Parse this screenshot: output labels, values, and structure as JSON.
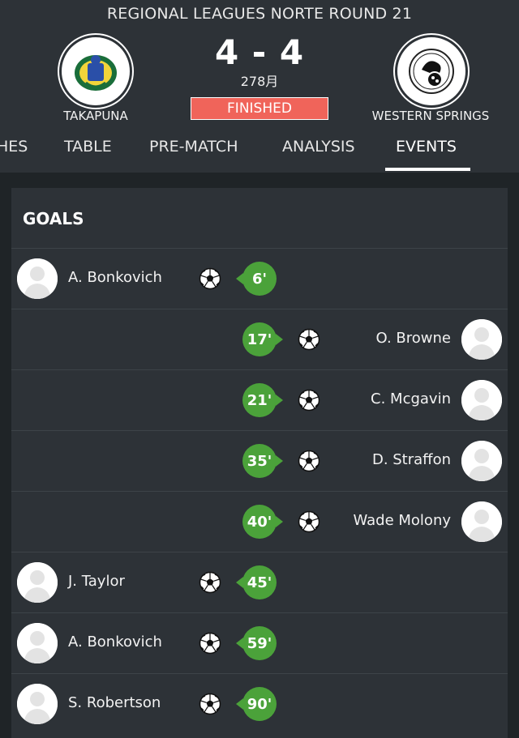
{
  "match": {
    "league_title": "REGIONAL LEAGUES  NORTE ROUND 21",
    "home_team": "TAKAPUNA",
    "away_team": "WESTERN SPRINGS",
    "score": "4 - 4",
    "date": "278月",
    "status": "FINISHED"
  },
  "tabs": [
    "HES",
    "TABLE",
    "PRE-MATCH",
    "ANALYSIS",
    "EVENTS"
  ],
  "active_tab": "EVENTS",
  "colors": {
    "background": "#1f2427",
    "panel": "#2d3237",
    "status_badge": "#f0645a",
    "minute_badge": "#4ba23a"
  },
  "goals_section": {
    "title": "GOALS",
    "events": [
      {
        "side": "home",
        "player": "A. Bonkovich",
        "minute": "6'",
        "icon": "soccer-ball-icon"
      },
      {
        "side": "away",
        "player": "O. Browne",
        "minute": "17'",
        "icon": "soccer-ball-icon"
      },
      {
        "side": "away",
        "player": "C. Mcgavin",
        "minute": "21'",
        "icon": "soccer-ball-icon"
      },
      {
        "side": "away",
        "player": "D. Straffon",
        "minute": "35'",
        "icon": "soccer-ball-icon"
      },
      {
        "side": "away",
        "player": "Wade Molony",
        "minute": "40'",
        "icon": "soccer-ball-icon"
      },
      {
        "side": "home",
        "player": "J. Taylor",
        "minute": "45'",
        "icon": "soccer-ball-icon"
      },
      {
        "side": "home",
        "player": "A. Bonkovich",
        "minute": "59'",
        "icon": "soccer-ball-icon"
      },
      {
        "side": "home",
        "player": "S. Robertson",
        "minute": "90'",
        "icon": "soccer-ball-icon"
      }
    ]
  }
}
